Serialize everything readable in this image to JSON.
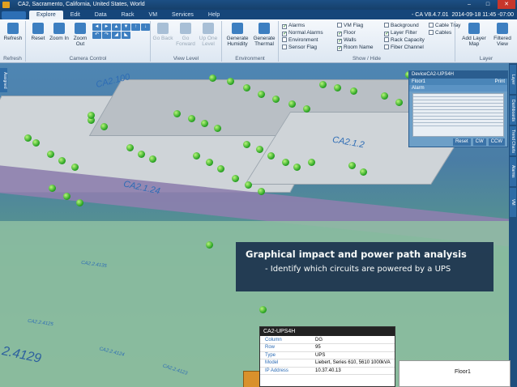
{
  "window": {
    "title": "CA2, Sacramento, California, United States, World"
  },
  "menu": {
    "tabs": [
      "Explore",
      "Edit",
      "Data",
      "Rack",
      "VM",
      "Services",
      "Help"
    ],
    "active": "Explore",
    "version": "- CA V8.4.7.01",
    "datetime": "2014-09-18 11:45 -07:00"
  },
  "ribbon": {
    "refresh": {
      "button": "Refresh",
      "group": "Refresh"
    },
    "camera": {
      "reset": "Reset",
      "zoom_in": "Zoom In",
      "zoom_out": "Zoom Out",
      "group": "Camera Control"
    },
    "view_level": {
      "back": "Go Back",
      "forward": "Go Forward",
      "up": "Up One Level",
      "group": "View Level"
    },
    "environment": {
      "humidity": "Generate Humidity",
      "thermal": "Generate Thermal",
      "group": "Environment"
    },
    "show_hide": {
      "group": "Show / Hide",
      "items": [
        {
          "label": "Alarms",
          "checked": true
        },
        {
          "label": "Normal Alarms",
          "checked": true
        },
        {
          "label": "Environment",
          "checked": false
        },
        {
          "label": "Sensor Flag",
          "checked": false
        },
        {
          "label": "VM Flag",
          "checked": false
        },
        {
          "label": "Floor",
          "checked": true
        },
        {
          "label": "Walls",
          "checked": true
        },
        {
          "label": "Room Name",
          "checked": true
        },
        {
          "label": "Background",
          "checked": false
        },
        {
          "label": "Layer Filter",
          "checked": true
        },
        {
          "label": "Rack Capacity",
          "checked": false
        },
        {
          "label": "Fiber Channel",
          "checked": false
        },
        {
          "label": "Cable Tray",
          "checked": false
        },
        {
          "label": "Cables",
          "checked": false
        }
      ]
    },
    "layer": {
      "add_map": "Add Layer Map",
      "filtered_view": "Filtered View",
      "group": "Layer"
    }
  },
  "zones": {
    "z100": "CA2.100",
    "z12": "CA2.1.2",
    "z124": "CA2.1.24",
    "z24135": "CA2.2.4135",
    "z24125": "CA2.2.4125",
    "z24124": "CA2.2.4124",
    "z24123": "CA2.2.4123",
    "z4129": "2.4129"
  },
  "device_window": {
    "title": "DeviceCA2-UPS4H",
    "floor": "Floor1",
    "print": "Print",
    "alarm": "Alarm",
    "buttons": [
      "Reset",
      "CW",
      "CCW"
    ]
  },
  "side_tabs": [
    "Layer",
    "Dashboards",
    "Trend Charts",
    "Alarms",
    "VM"
  ],
  "left_tab": "Assigned",
  "callout": {
    "heading": "Graphical impact and power path analysis",
    "sub": "- Identify which circuits are powered by a UPS"
  },
  "info_panel": {
    "title": "CA2-UPS4H",
    "rows": [
      {
        "key": "Column",
        "value": "DG"
      },
      {
        "key": "Row",
        "value": "95"
      },
      {
        "key": "Type",
        "value": "UPS"
      },
      {
        "key": "Model",
        "value": "Liebert, Series 610, 5610 1000kVA"
      },
      {
        "key": "IP Address",
        "value": "10.37.40.13"
      }
    ]
  },
  "floor_label": "Floor1",
  "colors": {
    "accent": "#2d6fb5",
    "callout": "#1e3650",
    "rack": "#29a323"
  }
}
